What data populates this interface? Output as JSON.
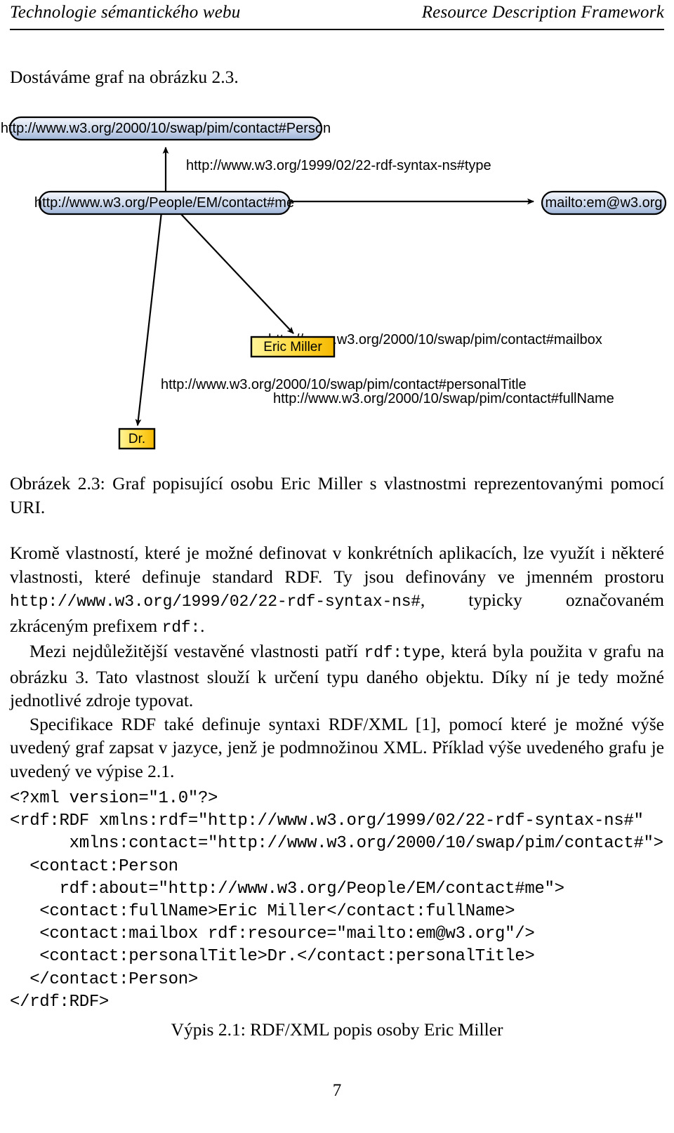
{
  "header": {
    "left": "Technologie sémantického webu",
    "right": "Resource Description Framework"
  },
  "intro": "Dostáváme graf na obrázku 2.3.",
  "figure": {
    "nodes": [
      {
        "id": "person",
        "kind": "resource",
        "label": "http://www.w3.org/2000/10/swap/pim/contact#Person"
      },
      {
        "id": "me",
        "kind": "resource",
        "label": "http://www.w3.org/People/EM/contact#me"
      },
      {
        "id": "mailto",
        "kind": "resource",
        "label": "mailto:em@w3.org"
      },
      {
        "id": "fullname",
        "kind": "literal",
        "label": "Eric Miller"
      },
      {
        "id": "title",
        "kind": "literal",
        "label": "Dr."
      }
    ],
    "edges": [
      {
        "from": "me",
        "to": "person",
        "label": "http://www.w3.org/1999/02/22-rdf-syntax-ns#type"
      },
      {
        "from": "me",
        "to": "mailto",
        "label": "http://www.w3.org/2000/10/swap/pim/contact#mailbox"
      },
      {
        "from": "me",
        "to": "fullname",
        "label": "http://www.w3.org/2000/10/swap/pim/contact#fullName"
      },
      {
        "from": "me",
        "to": "title",
        "label": "http://www.w3.org/2000/10/swap/pim/contact#personalTitle"
      }
    ],
    "colors": {
      "resource_fill_top": "#f2f5fb",
      "resource_fill_bottom": "#9fb4d8",
      "literal_fill_top": "#fff6b0",
      "literal_fill_bottom": "#f7bf00",
      "stroke": "#000000"
    }
  },
  "caption": "Obrázek 2.3: Graf popisující osobu Eric Miller s vlastnostmi reprezentovanými pomocí URI.",
  "paragraphs": {
    "p1_a": "Kromě vlastností, které je možné definovat v konkrétních aplikacích, lze využít i některé vlastnosti, které definuje standard RDF. Ty jsou definovány ve jmenném prostoru ",
    "p1_ns": "http://www.w3.org/1999/02/22-rdf-syntax-ns#",
    "p1_b": ", typicky označovaném zkráceným prefixem ",
    "p1_prefix": "rdf:",
    "p1_c": ".",
    "p2_a": "Mezi nejdůležitější vestavěné vlastnosti patří ",
    "p2_type": "rdf:type",
    "p2_b": ", která byla použita v grafu na obrázku 3. Tato vlastnost slouží k určení typu daného objektu. Díky ní je tedy možné jednotlivé zdroje typovat.",
    "p3": "Specifikace RDF také definuje syntaxi RDF/XML [1], pomocí které je možné výše uvedený graf zapsat v jazyce, jenž je podmnožinou XML. Příklad výše uvedeného grafu je uvedený ve výpise 2.1."
  },
  "listing": {
    "code": "<?xml version=\"1.0\"?>\n<rdf:RDF xmlns:rdf=\"http://www.w3.org/1999/02/22-rdf-syntax-ns#\"\n      xmlns:contact=\"http://www.w3.org/2000/10/swap/pim/contact#\">\n  <contact:Person\n     rdf:about=\"http://www.w3.org/People/EM/contact#me\">\n   <contact:fullName>Eric Miller</contact:fullName>\n   <contact:mailbox rdf:resource=\"mailto:em@w3.org\"/>\n   <contact:personalTitle>Dr.</contact:personalTitle>\n  </contact:Person>\n</rdf:RDF>",
    "caption": "Výpis 2.1: RDF/XML popis osoby Eric Miller"
  },
  "folio": "7"
}
